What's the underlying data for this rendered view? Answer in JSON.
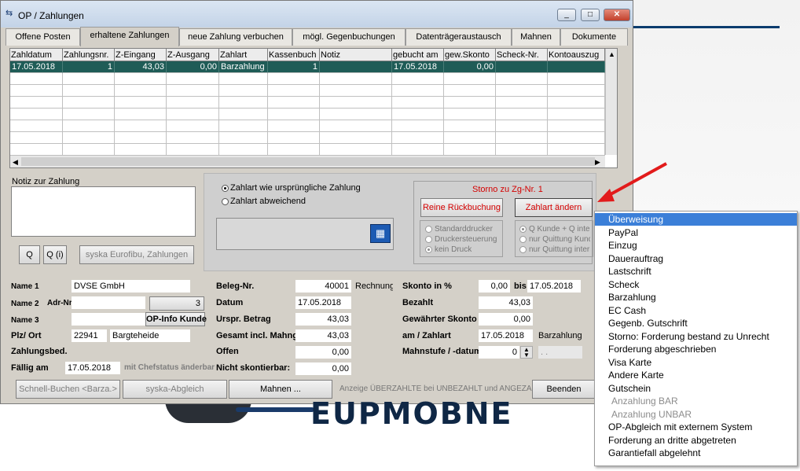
{
  "window": {
    "title": "OP / Zahlungen",
    "controls": {
      "minimize": "_",
      "maximize": "□",
      "close": "✕"
    }
  },
  "tabs": [
    {
      "label": "Offene Posten"
    },
    {
      "label": "erhaltene Zahlungen",
      "active": true
    },
    {
      "label": "neue Zahlung verbuchen"
    },
    {
      "label": "mögl. Gegenbuchungen"
    },
    {
      "label": "Datenträgeraustausch"
    },
    {
      "label": "Mahnen"
    },
    {
      "label": "Dokumente"
    }
  ],
  "grid": {
    "columns": [
      "Zahldatum",
      "Zahlungsnr.",
      "Z-Eingang",
      "Z-Ausgang",
      "Zahlart",
      "Kassenbuch",
      "Notiz",
      "gebucht am",
      "gew.Skonto",
      "Scheck-Nr.",
      "Kontoauszug"
    ],
    "rows": [
      [
        "17.05.2018",
        "1",
        "43,03",
        "0,00",
        "Barzahlung",
        "1",
        "",
        "17.05.2018",
        "0,00",
        "",
        ""
      ]
    ]
  },
  "notes": {
    "label": "Notiz zur Zahlung",
    "value": "",
    "buttons": {
      "q": "Q",
      "qi": "Q (i)",
      "syska": "syska Eurofibu, Zahlungen"
    }
  },
  "zahlart_options": {
    "original": "Zahlart wie ursprüngliche Zahlung",
    "abweichend": "Zahlart abweichend",
    "selected": "original"
  },
  "storno": {
    "title": "Storno zu Zg-Nr. 1",
    "reine_rueckbuchung": "Reine Rückbuchung",
    "zahlart_aendern": "Zahlart ändern",
    "printer_options": [
      "Standarddrucker",
      "Druckersteuerung",
      "kein Druck"
    ],
    "printer_selected": "kein Druck",
    "quittung_options": [
      "Q Kunde + Q intern",
      "nur Quittung Kunde",
      "nur Quittung intern"
    ],
    "quittung_selected": "Q Kunde + Q intern"
  },
  "form": {
    "name1_label": "Name 1",
    "name1": "DVSE GmbH",
    "name2_label": "Name 2",
    "adr_label": "Adr-Nr.",
    "adr_value": "3",
    "name3_label": "Name 3",
    "op_info_button": "OP-Info Kunde",
    "plz_label": "Plz/ Ort",
    "plz": "22941",
    "ort": "Bargteheide",
    "zahlungsbed_label": "Zahlungsbed.",
    "faellig_label": "Fällig am",
    "faellig": "17.05.2018",
    "chefstatus": "mit Chefstatus änderbar",
    "beleg_label": "Beleg-Nr.",
    "beleg": "40001",
    "beleg_type": "Rechnung",
    "datum_label": "Datum",
    "datum": "17.05.2018",
    "urspr_label": "Urspr. Betrag",
    "urspr": "43,03",
    "gesamt_label": "Gesamt incl. Mahng.",
    "gesamt": "43,03",
    "offen_label": "Offen",
    "offen": "0,00",
    "nicht_skonto_label": "Nicht skontierbar:",
    "nicht_skonto": "0,00",
    "skonto_label": "Skonto in %",
    "skonto": "0,00",
    "bis_label": "bis",
    "bis": "17.05.2018",
    "bezahlt_label": "Bezahlt",
    "bezahlt": "43,03",
    "gew_skonto_label": "Gewährter Skonto",
    "gew_skonto": "0,00",
    "am_zahlart_label": "am / Zahlart",
    "am": "17.05.2018",
    "zahlart": "Barzahlung",
    "mahnstufe_label": "Mahnstufe / -datum",
    "mahnstufe": "0",
    "mahndatum": ". ."
  },
  "bottom": {
    "schnell": "Schnell-Buchen <Barza.>",
    "syska_abgleich": "syska-Abgleich",
    "mahnen": "Mahnen ...",
    "anzeige": "Anzeige ÜBERZAHLTE bei UNBEZAHLT und ANGEZAHLT",
    "beenden": "Beenden"
  },
  "menu": {
    "items": [
      {
        "label": "Überweisung",
        "highlighted": true
      },
      {
        "label": "PayPal"
      },
      {
        "label": "Einzug"
      },
      {
        "label": "Dauerauftrag"
      },
      {
        "label": "Lastschrift"
      },
      {
        "label": "Scheck"
      },
      {
        "label": "Barzahlung"
      },
      {
        "label": "EC Cash"
      },
      {
        "label": "Gegenb. Gutschrift"
      },
      {
        "label": "Storno: Forderung bestand zu Unrecht"
      },
      {
        "label": "Forderung abgeschrieben"
      },
      {
        "label": "Visa Karte"
      },
      {
        "label": "Andere Karte"
      },
      {
        "label": "Gutschein"
      },
      {
        "label": "Anzahlung BAR",
        "disabled": true
      },
      {
        "label": "Anzahlung UNBAR",
        "disabled": true
      },
      {
        "label": "OP-Abgleich mit externem System"
      },
      {
        "label": "Forderung an dritte abgetreten"
      },
      {
        "label": "Garantiefall abgelehnt"
      }
    ]
  },
  "colors": {
    "selected_row": "#1f5c57",
    "menu_highlight": "#3b7fd8",
    "storno_red": "#d40000",
    "arrow_red": "#e21b1b"
  }
}
